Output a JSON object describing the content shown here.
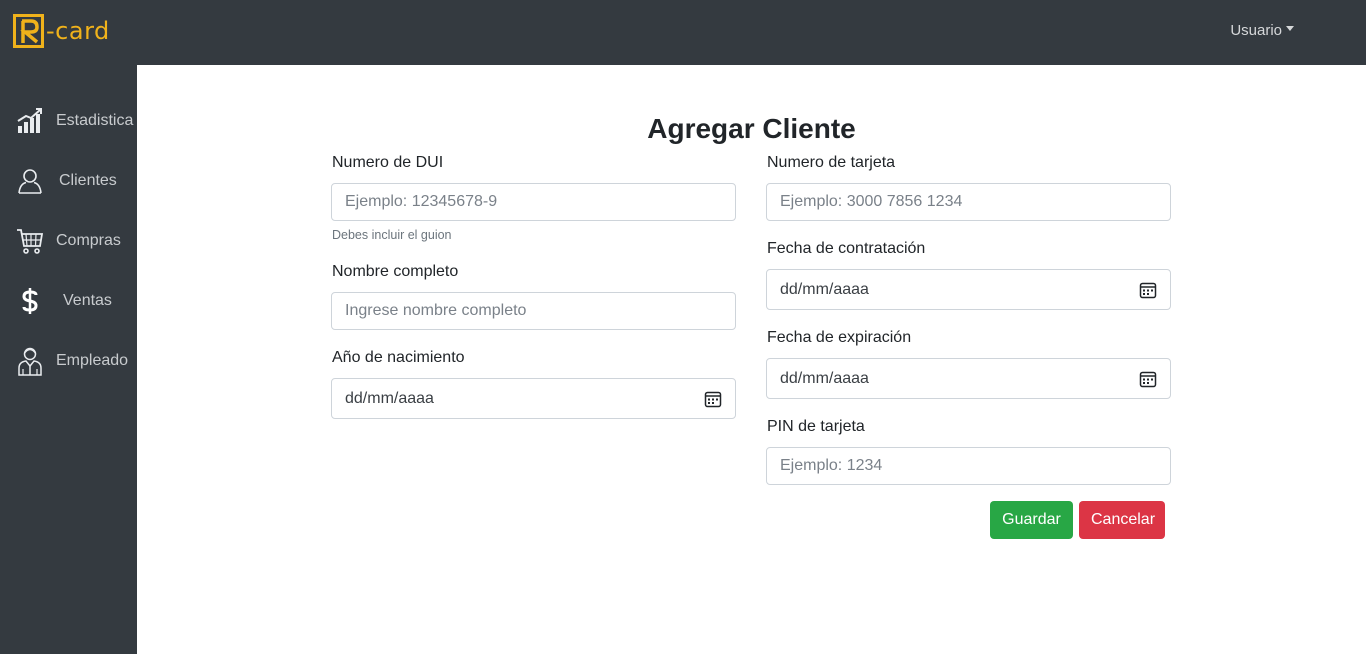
{
  "brand": {
    "logo_letter": "R",
    "logo_text": "-card",
    "accent_color": "#f0b21b"
  },
  "header": {
    "user_label": "Usuario"
  },
  "sidebar": {
    "items": [
      {
        "label": "Estadistica",
        "icon": "bar-chart-icon"
      },
      {
        "label": "Clientes",
        "icon": "user-icon"
      },
      {
        "label": "Compras",
        "icon": "cart-icon"
      },
      {
        "label": "Ventas",
        "icon": "dollar-icon"
      },
      {
        "label": "Empleado",
        "icon": "employee-icon"
      }
    ]
  },
  "form": {
    "title": "Agregar Cliente",
    "dui": {
      "label": "Numero de DUI",
      "placeholder": "Ejemplo: 12345678-9",
      "help": "Debes incluir el guion"
    },
    "nombre": {
      "label": "Nombre completo",
      "placeholder": "Ingrese nombre completo"
    },
    "nacimiento": {
      "label": "Año de nacimiento",
      "value": "dd/mm/aaaa"
    },
    "tarjeta": {
      "label": "Numero de tarjeta",
      "placeholder": "Ejemplo: 3000 7856 1234"
    },
    "contratacion": {
      "label": "Fecha de contratación",
      "value": "dd/mm/aaaa"
    },
    "expiracion": {
      "label": "Fecha de expiración",
      "value": "dd/mm/aaaa"
    },
    "pin": {
      "label": "PIN de tarjeta",
      "placeholder": "Ejemplo: 1234"
    },
    "save_label": "Guardar",
    "cancel_label": "Cancelar"
  },
  "colors": {
    "dark_bg": "#343a40",
    "success": "#28a745",
    "danger": "#dc3545"
  }
}
